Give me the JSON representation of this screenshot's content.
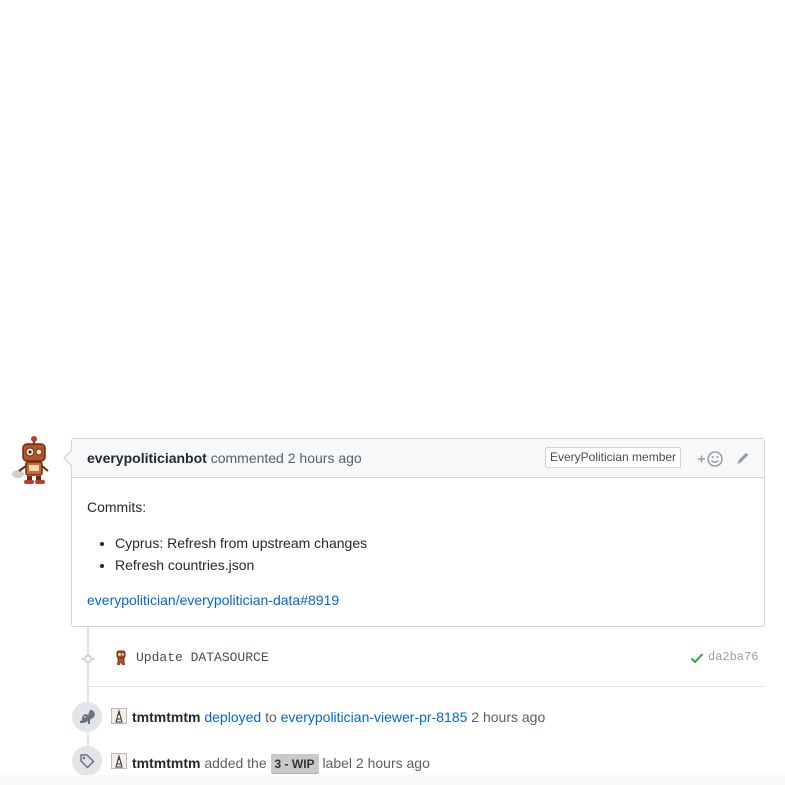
{
  "comment": {
    "author": "everypoliticianbot",
    "action": "commented",
    "time": "2 hours ago",
    "badge": "EveryPolitician member",
    "body_heading": "Commits:",
    "commits": [
      "Cyprus: Refresh from upstream changes",
      "Refresh countries.json"
    ],
    "reference": "everypolitician/everypolitician-data#8919"
  },
  "commit_row": {
    "message": "Update DATASOURCE",
    "sha": "da2ba76",
    "status_color": "#28a745"
  },
  "deploy_event": {
    "actor": "tmtmtmtm",
    "verb": "deployed",
    "connector": "to",
    "environment": "everypolitician-viewer-pr-8185",
    "time": "2 hours ago"
  },
  "label_event": {
    "actor": "tmtmtmtm",
    "verb": "added the",
    "label": "3 - WIP",
    "suffix": "label",
    "time": "2 hours ago",
    "label_color": "#c9c9c9"
  },
  "colors": {
    "link": "#0366d6",
    "border": "#d1d5da",
    "header_bg": "#f6f8fa"
  }
}
